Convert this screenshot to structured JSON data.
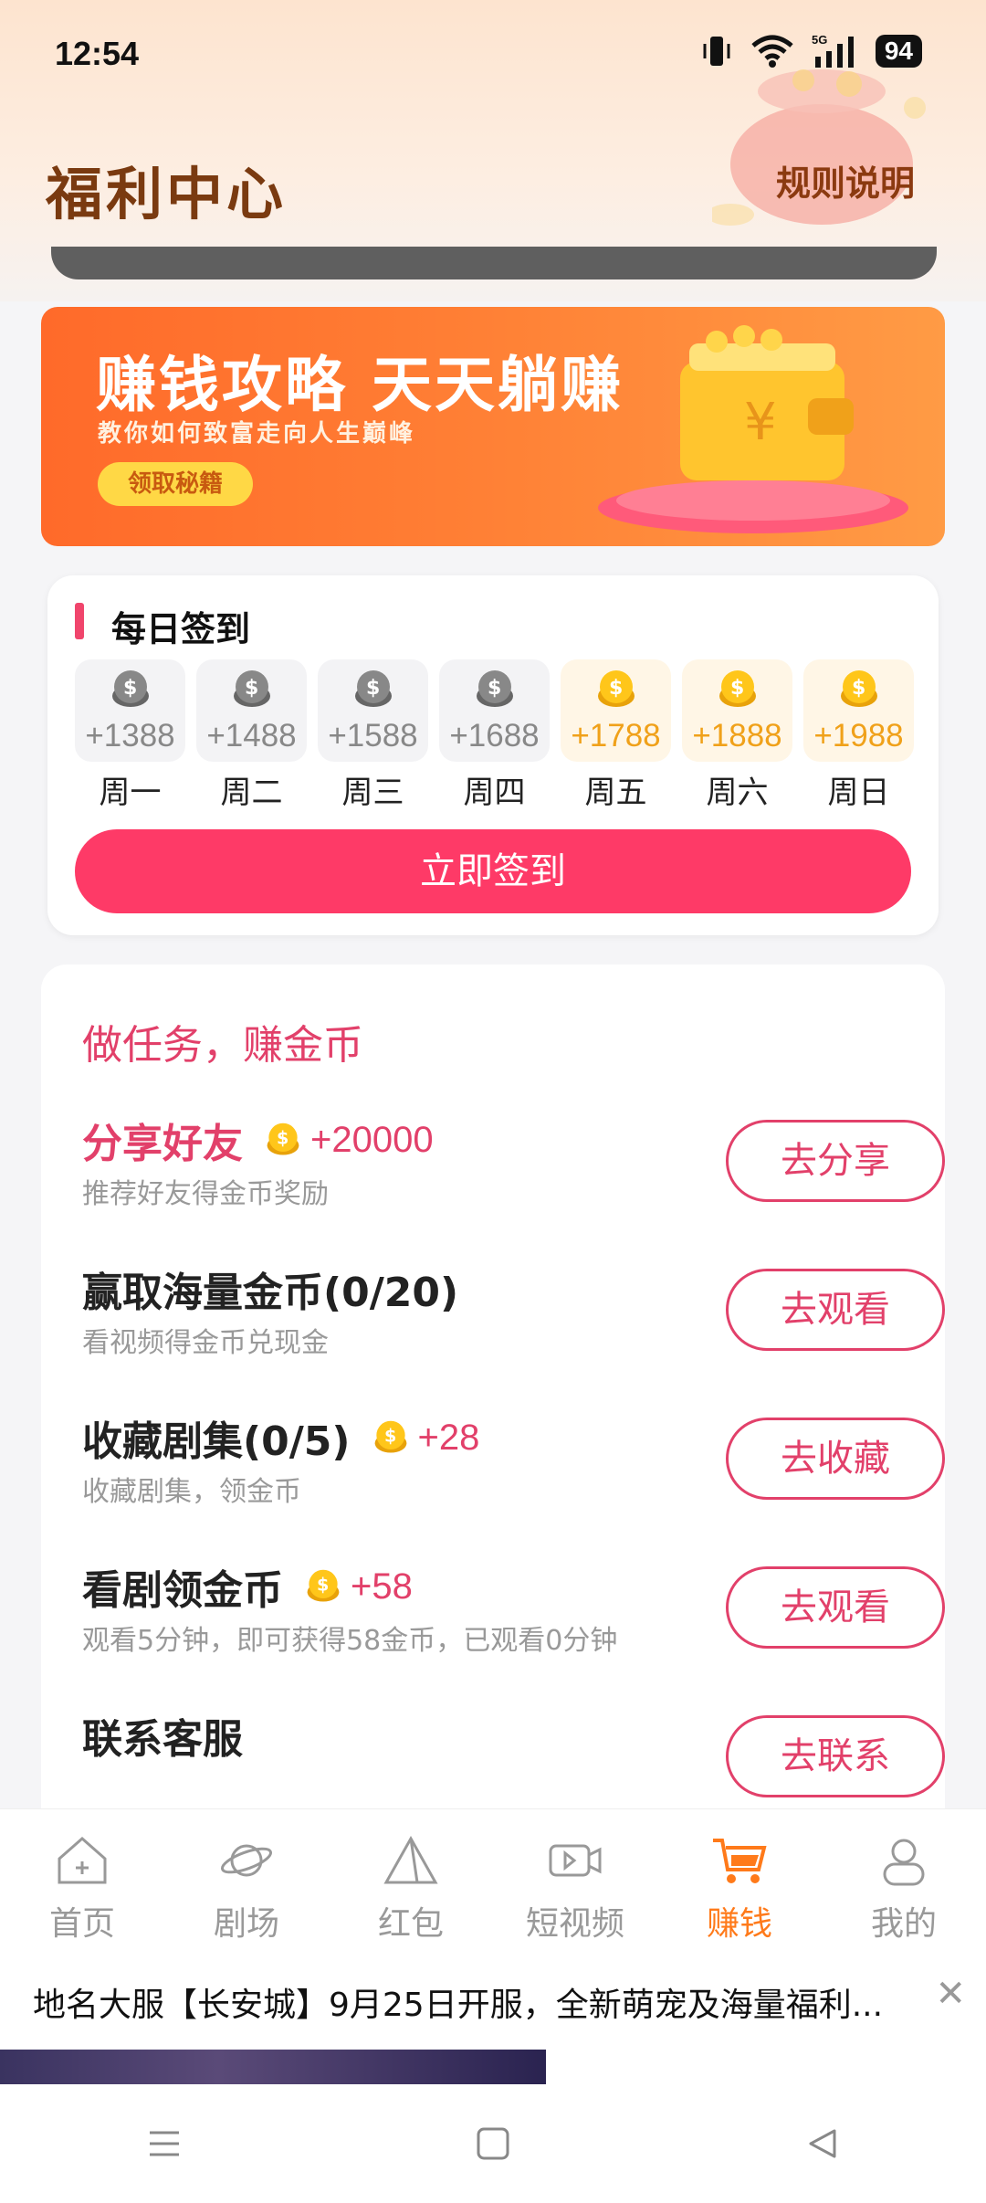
{
  "status_bar": {
    "time": "12:54",
    "network": "5G",
    "battery": "94"
  },
  "header": {
    "title": "福利中心",
    "rules_label": "规则说明"
  },
  "banner": {
    "title": "赚钱攻略 天天躺赚",
    "subtitle": "教你如何致富走向人生巅峰",
    "button_label": "领取秘籍"
  },
  "checkin": {
    "title": "每日签到",
    "days": [
      {
        "label": "周一",
        "reward": "+1388",
        "state": "claimed"
      },
      {
        "label": "周二",
        "reward": "+1488",
        "state": "claimed"
      },
      {
        "label": "周三",
        "reward": "+1588",
        "state": "claimed"
      },
      {
        "label": "周四",
        "reward": "+1688",
        "state": "claimed"
      },
      {
        "label": "周五",
        "reward": "+1788",
        "state": "available"
      },
      {
        "label": "周六",
        "reward": "+1888",
        "state": "available"
      },
      {
        "label": "周日",
        "reward": "+1988",
        "state": "available"
      }
    ],
    "button_label": "立即签到"
  },
  "tasks": {
    "section_title": "做任务，赚金币",
    "items": [
      {
        "title": "分享好友",
        "reward": "+20000",
        "desc": "推荐好友得金币奖励",
        "button": "去分享",
        "highlight": true
      },
      {
        "title": "赢取海量金币(0/20)",
        "reward": "",
        "desc": "看视频得金币兑现金",
        "button": "去观看",
        "highlight": false
      },
      {
        "title": "收藏剧集(0/5)",
        "reward": "+28",
        "desc": "收藏剧集，领金币",
        "button": "去收藏",
        "highlight": false
      },
      {
        "title": "看剧领金币",
        "reward": "+58",
        "desc": "观看5分钟，即可获得58金币，已观看0分钟",
        "button": "去观看",
        "highlight": false
      },
      {
        "title": "联系客服",
        "reward": "",
        "desc": "",
        "button": "去联系",
        "highlight": false
      }
    ]
  },
  "tabbar": {
    "items": [
      {
        "label": "首页",
        "icon": "home-icon"
      },
      {
        "label": "剧场",
        "icon": "planet-icon"
      },
      {
        "label": "红包",
        "icon": "triangle-icon"
      },
      {
        "label": "短视频",
        "icon": "video-icon"
      },
      {
        "label": "赚钱",
        "icon": "cart-icon",
        "active": true
      },
      {
        "label": "我的",
        "icon": "profile-icon"
      }
    ]
  },
  "ad": {
    "text": "地名大服【长安城】9月25日开服，全新萌宠及海量福利..."
  },
  "colors": {
    "accent": "#fe3a67",
    "task_pink": "#e2406a",
    "active_tab": "#ff7a1a",
    "gold": "#f0a11a"
  }
}
